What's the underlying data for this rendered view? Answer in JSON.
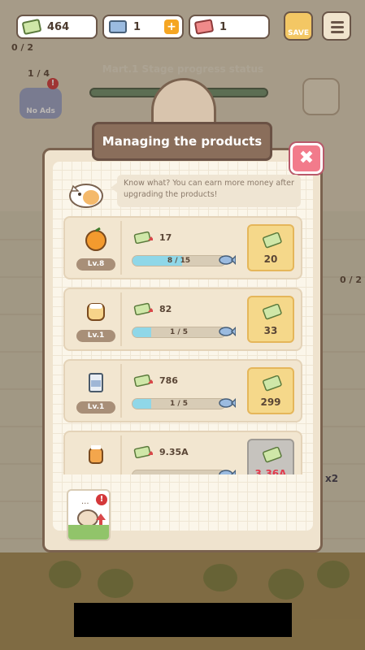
{
  "hud": {
    "cash": "464",
    "fish": "1",
    "tickets": "1",
    "plus": "+",
    "save_label": "SAVE"
  },
  "background": {
    "stage_title": "Mart.1 Stage progress status",
    "counter_a": "0 / 2",
    "counter_b": "1 / 4",
    "no_ads": "No Ads",
    "counter_c": "0 / 2",
    "multiplier": "x2"
  },
  "modal": {
    "title": "Managing the products",
    "close": "✖",
    "tip": "Know what? You can earn more money after upgrading the products!",
    "products": [
      {
        "name": "orange",
        "level": "Lv.8",
        "earn": "17",
        "progress_text": "8 / 15",
        "progress": 0.5333,
        "cost_type": "fish",
        "price": "20",
        "state": "available"
      },
      {
        "name": "pudding",
        "level": "Lv.1",
        "earn": "82",
        "progress_text": "1 / 5",
        "progress": 0.2,
        "cost_type": "fish-pot",
        "price": "33",
        "state": "available"
      },
      {
        "name": "milk-carton",
        "level": "Lv.1",
        "earn": "786",
        "progress_text": "1 / 5",
        "progress": 0.2,
        "cost_type": "fish",
        "price": "299",
        "state": "available"
      },
      {
        "name": "honey-jar",
        "level": "",
        "earn": "9.35A",
        "progress_text": "",
        "progress": 0,
        "cost_type": "fish-pot",
        "price": "3.36A",
        "state": "locked"
      }
    ]
  },
  "colors": {
    "accent_gold": "#f5d88a",
    "progress_cyan": "#8fd7e8",
    "close_pink": "#f27b8b",
    "locked_price_red": "#e23a4c",
    "header_brown": "#8a6e5b"
  }
}
